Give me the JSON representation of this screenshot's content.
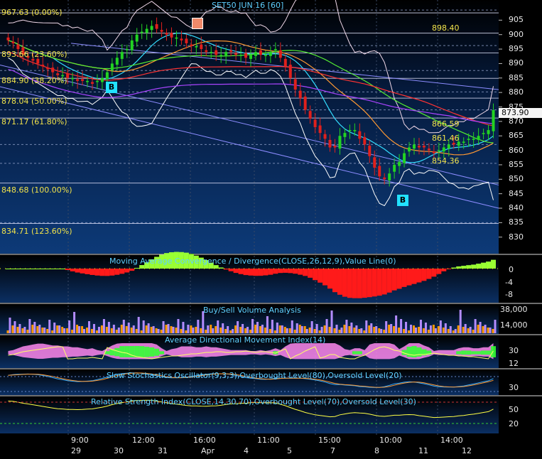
{
  "panels": {
    "price_title": "SET50 JUN 16  [60]",
    "macd_title": "Moving Average Convergence / Divergence(CLOSE,26,12,9),Value Line(0)",
    "volume_title": "Buy/Sell Volume Analysis",
    "adx_title": "Average Directional Movement Index(14)",
    "stoch_title": "Slow Stochastics Oscillator(9,3,3),Overbought Level(80),Oversold Level(20)",
    "rsi_title": "Relative Strength Index(CLOSE,14,30,70),Overbought Level(70),Oversold Level(30)"
  },
  "fib_levels": [
    {
      "label": "967.63 (0.00%)",
      "value": 967.63
    },
    {
      "label": "893.66 (23.60%)",
      "value": 893.66
    },
    {
      "label": "884.90 (38.20%)",
      "value": 884.9
    },
    {
      "label": "878.04 (50.00%)",
      "value": 878.04
    },
    {
      "label": "871.17 (61.80%)",
      "value": 871.17
    },
    {
      "label": "848.68 (100.00%)",
      "value": 848.68
    },
    {
      "label": "834.71 (123.60%)",
      "value": 834.71
    }
  ],
  "price_axis": [
    "905",
    "900",
    "895",
    "890",
    "885",
    "880",
    "875",
    "870",
    "865",
    "860",
    "855",
    "850",
    "845",
    "840",
    "835",
    "830"
  ],
  "price_annotations": [
    "898.40",
    "866.59",
    "861.46",
    "854.36"
  ],
  "last_price": "873.90",
  "signals": {
    "buy1": "B",
    "buy2": "B"
  },
  "macd_axis": [
    "0",
    "-4",
    "-8"
  ],
  "volume_axis": [
    "38,000",
    "14,000"
  ],
  "adx_axis": [
    "30",
    "12"
  ],
  "stoch_axis": [
    "30"
  ],
  "rsi_axis": [
    "50",
    "20"
  ],
  "time_axis": [
    "9:00",
    "12:00",
    "16:00",
    "11:00",
    "15:00",
    "10:00",
    "14:00"
  ],
  "date_axis": [
    "29",
    "30",
    "31",
    "Apr",
    "4",
    "5",
    "7",
    "8",
    "11",
    "12"
  ],
  "colors": {
    "price_bg_top": "#000000",
    "price_bg_bottom": "#0d3a78",
    "bull": "#22d322",
    "bear": "#e0201c",
    "fib_line": "#e8e8ff",
    "macd_neg": "#ff1a1a",
    "macd_pos": "#99ff33",
    "volume_buy": "#ff9900",
    "volume_sell": "#b38cff",
    "adx_pos": "#ff88ee",
    "adx_neg": "#33ff33"
  },
  "chart_data": {
    "type": "line",
    "title": "SET50 JUN 16  [60]",
    "ylim": [
      826,
      910
    ],
    "closes": [
      898,
      897,
      895,
      893,
      892,
      891,
      890,
      889,
      888,
      887,
      886,
      886,
      885,
      885,
      884,
      884,
      884,
      883,
      884,
      885,
      887,
      890,
      892,
      894,
      895,
      898,
      900,
      901,
      902,
      903,
      902,
      901,
      900,
      899,
      899,
      898,
      897,
      896,
      896,
      895,
      894,
      894,
      893,
      893,
      894,
      894,
      893,
      893,
      892,
      893,
      894,
      893,
      893,
      894,
      895,
      892,
      889,
      885,
      881,
      878,
      874,
      871,
      868,
      866,
      864,
      861,
      861,
      865,
      866,
      867,
      867,
      864,
      862,
      858,
      854,
      851,
      850,
      852,
      855,
      856,
      859,
      861,
      862,
      861,
      861,
      860,
      859,
      860,
      861,
      862,
      862,
      863,
      863,
      864,
      864,
      865,
      866,
      867,
      873.9
    ],
    "last": 873.9
  }
}
